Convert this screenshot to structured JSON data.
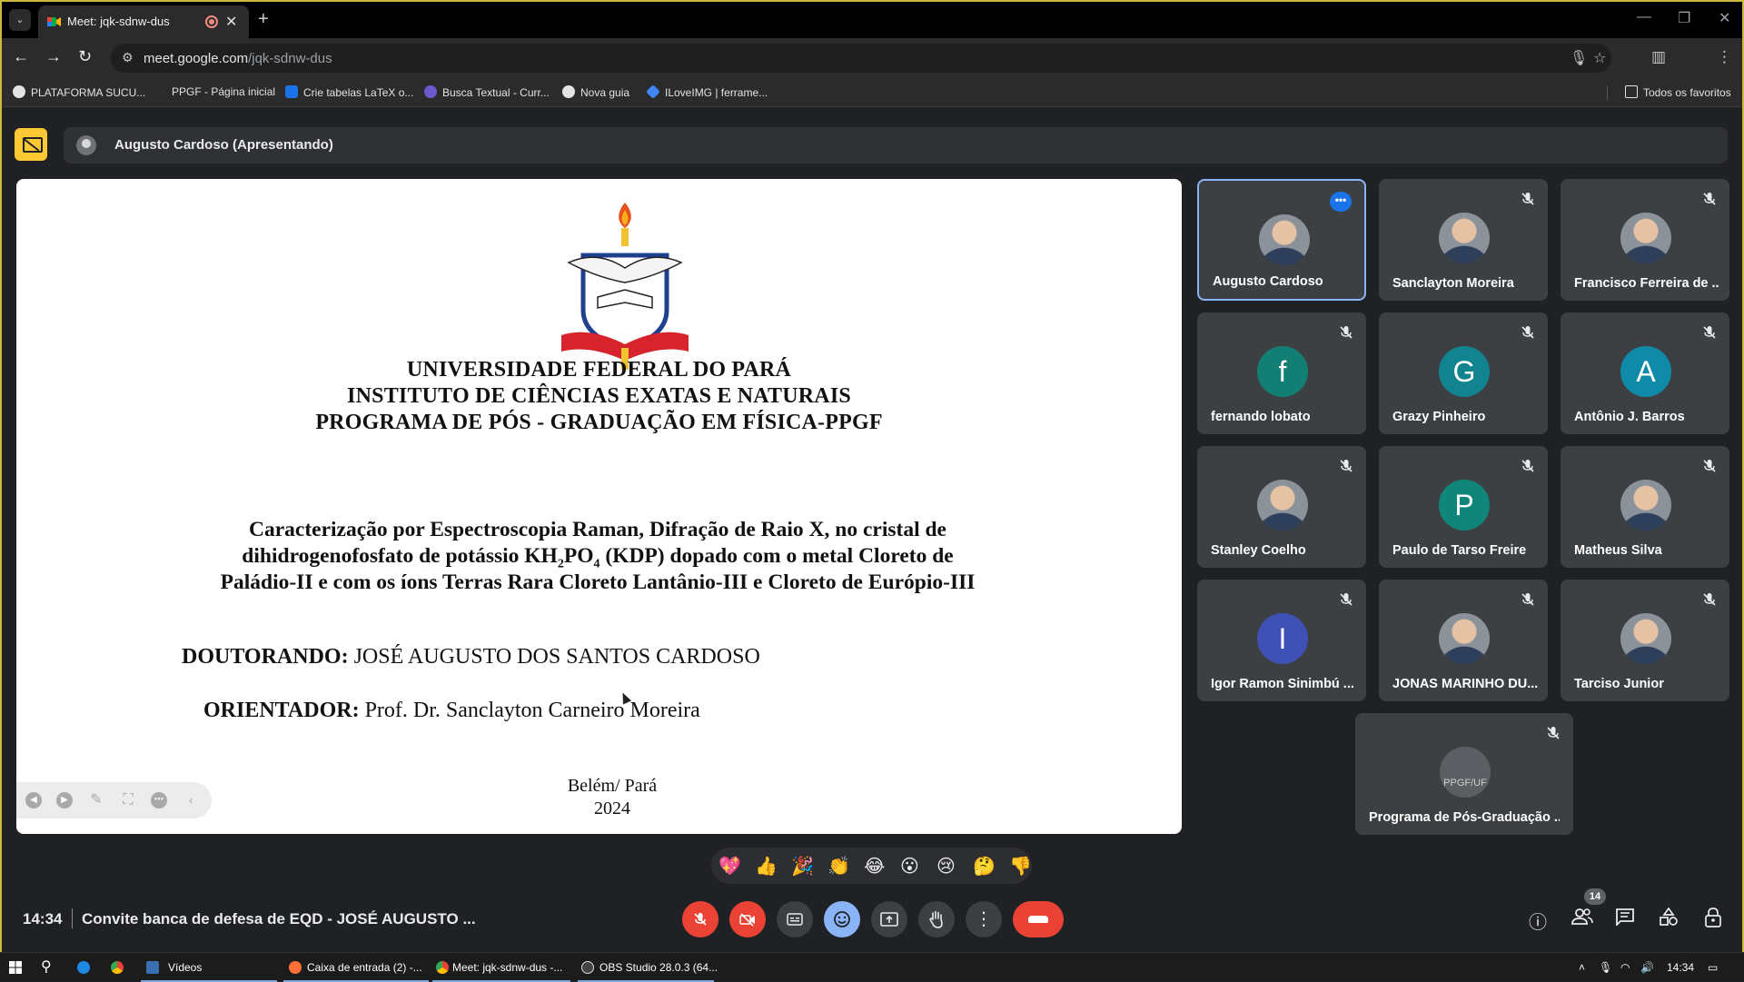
{
  "browser": {
    "tab_title": "Meet: jqk-sdnw-dus",
    "new_tab_label": "+",
    "url_domain": "meet.google.com",
    "url_path": "/jqk-sdnw-dus"
  },
  "bookmarks": {
    "items": [
      {
        "label": "PLATAFORMA SUCU...",
        "icon": "globe-icon"
      },
      {
        "label": "PPGF - Página inicial",
        "icon": "bookmark-icon"
      },
      {
        "label": "Crie tabelas LaTeX o...",
        "icon": "table-icon"
      },
      {
        "label": "Busca Textual - Curr...",
        "icon": "lattes-icon"
      },
      {
        "label": "Nova guia",
        "icon": "globe-icon"
      },
      {
        "label": "ILoveIMG | ferrame...",
        "icon": "heart-icon"
      }
    ],
    "all_bookmarks": "Todos os favoritos"
  },
  "presenter": {
    "label": "Augusto Cardoso (Apresentando)"
  },
  "slide": {
    "header_lines": [
      "UNIVERSIDADE FEDERAL DO PARÁ",
      "INSTITUTO DE CIÊNCIAS EXATAS E NATURAIS",
      "PROGRAMA DE PÓS - GRADUAÇÃO EM FÍSICA-PPGF"
    ],
    "crest_text": "UNIVERSIDADE FEDERAL DO PARÁ",
    "thesis_line1": "Caracterização por Espectroscopia Raman, Difração de Raio X, no cristal de",
    "thesis_line2_a": "dihidrogenofosfato de potássio KH",
    "thesis_line2_sub1": "2",
    "thesis_line2_b": "PO",
    "thesis_line2_sub2": "4",
    "thesis_line2_c": " (KDP) dopado com o metal  Cloreto de",
    "thesis_line3": "Paládio-II e com os íons Terras Rara Cloreto Lantânio-III e Cloreto de Európio-III",
    "student_label": "DOUTORANDO:",
    "student_name": "JOSÉ AUGUSTO DOS SANTOS CARDOSO",
    "advisor_label": "ORIENTADOR:",
    "advisor_name": "Prof. Dr. Sanclayton Carneiro Moreira",
    "city": "Belém/ Pará",
    "year": "2024"
  },
  "participants": [
    {
      "name": "Augusto Cardoso",
      "avatar": "photo"
    },
    {
      "name": "Sanclayton Moreira",
      "avatar": "photo"
    },
    {
      "name": "Francisco Ferreira de ...",
      "avatar": "photo"
    },
    {
      "name": "fernando lobato",
      "initial": "f",
      "color": "#137f74"
    },
    {
      "name": "Grazy Pinheiro",
      "initial": "G",
      "color": "#12848f"
    },
    {
      "name": "Antônio J. Barros",
      "initial": "A",
      "color": "#0f8aa8"
    },
    {
      "name": "Stanley Coelho",
      "avatar": "photo"
    },
    {
      "name": "Paulo de Tarso Freire",
      "initial": "P",
      "color": "#10857a"
    },
    {
      "name": "Matheus Silva",
      "avatar": "photo"
    },
    {
      "name": "Igor Ramon Sinimbú ...",
      "initial": "I",
      "color": "#3f51b5"
    },
    {
      "name": "JONAS MARINHO DU...",
      "avatar": "photo"
    },
    {
      "name": "Tarciso Junior",
      "avatar": "photo"
    },
    {
      "name": "Programa de Pós-Graduação ...",
      "avatar": "logo",
      "logo_text": "PPGF/UF"
    }
  ],
  "reactions": [
    "💖",
    "👍",
    "🎉",
    "👏",
    "😂",
    "😮",
    "😢",
    "🤔",
    "👎"
  ],
  "call": {
    "time": "14:34",
    "meeting_title": "Convite banca de defesa de EQD - JOSÉ AUGUSTO ...",
    "people_count": "14"
  },
  "taskbar": {
    "items": [
      {
        "label": "Vídeos"
      },
      {
        "label": "Caixa de entrada (2) -..."
      },
      {
        "label": "Meet: jqk-sdnw-dus -..."
      },
      {
        "label": "OBS Studio 28.0.3 (64..."
      }
    ],
    "clock": "14:34"
  },
  "colors": {
    "meet_bg": "#202124",
    "tile_bg": "#3c4043",
    "accent_blue": "#8ab4f8",
    "end_call_red": "#ea4335",
    "present_yellow": "#fcc934"
  }
}
